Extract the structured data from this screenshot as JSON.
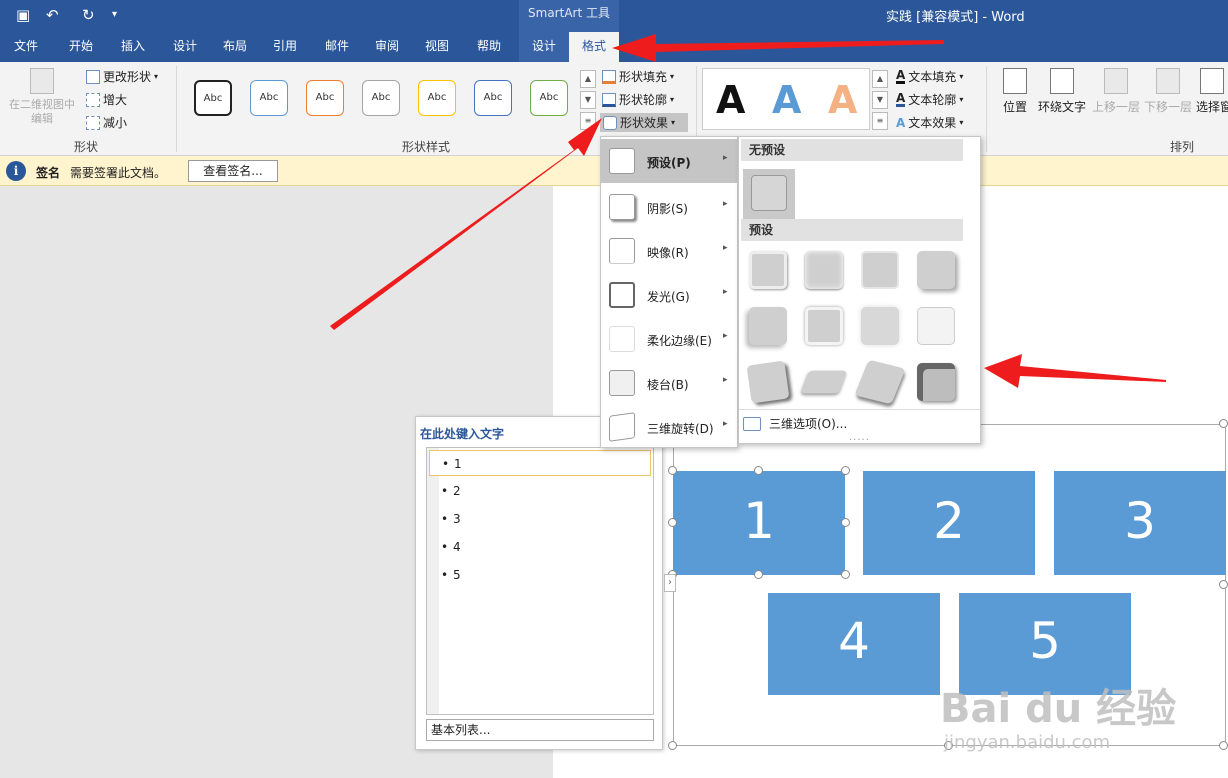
{
  "window": {
    "contextual_title": "SmartArt 工具",
    "doc_title": "实践 [兼容模式]  -  Word"
  },
  "tabs": [
    {
      "label": "文件"
    },
    {
      "label": "开始"
    },
    {
      "label": "插入"
    },
    {
      "label": "设计"
    },
    {
      "label": "布局"
    },
    {
      "label": "引用"
    },
    {
      "label": "邮件"
    },
    {
      "label": "审阅"
    },
    {
      "label": "视图"
    },
    {
      "label": "帮助"
    },
    {
      "label": "设计"
    },
    {
      "label": "格式"
    }
  ],
  "ribbon": {
    "shape_group": {
      "edit_2d": "在二维视图中编辑",
      "change_shape": "更改形状",
      "larger": "增大",
      "smaller": "减小",
      "label": "形状"
    },
    "shape_styles": {
      "swatch_label": "Abc",
      "swatch_colors": [
        "#222222",
        "#5b9bd5",
        "#ed7d31",
        "#a5a5a5",
        "#ffc000",
        "#4472c4",
        "#70ad47"
      ],
      "fill": "形状填充",
      "outline": "形状轮廓",
      "effects": "形状效果",
      "label": "形状样式"
    },
    "wordart": {
      "glyph": "A",
      "text_fill": "文本填充",
      "text_outline": "文本轮廓",
      "text_effects": "文本效果"
    },
    "arrange": {
      "position": "位置",
      "wrap_text": "环绕文字",
      "bring_forward": "上移一层",
      "send_backward": "下移一层",
      "selection_pane": "选择窗",
      "label": "排列"
    }
  },
  "message_bar": {
    "icon": "i",
    "title": "签名",
    "text": "需要签署此文档。",
    "button": "查看签名..."
  },
  "effects_menu": {
    "items": [
      {
        "label": "预设(P)"
      },
      {
        "label": "阴影(S)"
      },
      {
        "label": "映像(R)"
      },
      {
        "label": "发光(G)"
      },
      {
        "label": "柔化边缘(E)"
      },
      {
        "label": "棱台(B)"
      },
      {
        "label": "三维旋转(D)"
      }
    ],
    "arrow": "▸"
  },
  "preset_submenu": {
    "no_preset_header": "无预设",
    "preset_header": "预设",
    "options_label": "三维选项(O)...",
    "grip": "....."
  },
  "text_pane": {
    "title": "在此处键入文字",
    "items": [
      "1",
      "2",
      "3",
      "4",
      "5"
    ],
    "footer": "基本列表...",
    "toggle": "›"
  },
  "smartart": {
    "boxes": [
      "1",
      "2",
      "3",
      "4",
      "5"
    ],
    "color": "#5b9bd5"
  },
  "watermark": {
    "logo": "Bai du 经验",
    "url": "jingyan.baidu.com"
  }
}
